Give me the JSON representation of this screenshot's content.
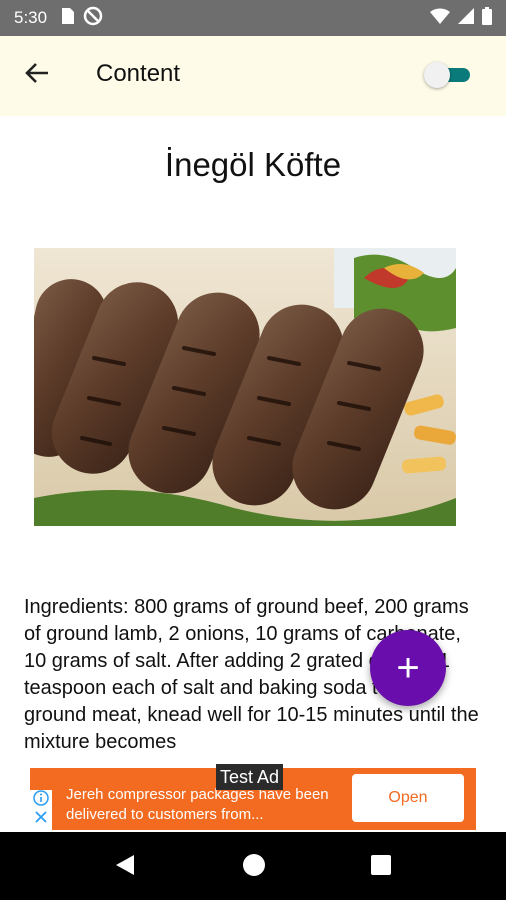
{
  "status_bar": {
    "time": "5:30",
    "icons": [
      "sd-card-icon",
      "do-not-disturb-icon",
      "wifi-icon",
      "cellular-signal-icon",
      "battery-icon"
    ]
  },
  "app_bar": {
    "title": "Content",
    "back_icon": "arrow-left-icon",
    "toggle_on": true
  },
  "recipe": {
    "title": "İnegöl Köfte",
    "image_description": "grilled meatballs",
    "text": "Ingredients: 800 grams of ground beef, 200 grams of ground lamb, 2 onions, 10 grams of carbonate, 10 grams of salt. After adding 2 grated onions, 1 teaspoon each of salt and baking soda to the ground meat, knead well for 10-15 minutes until the mixture becomes"
  },
  "fab": {
    "icon": "plus-icon",
    "label": "+"
  },
  "ad": {
    "badge": "Test Ad",
    "text": "Jereh compressor packages have been delivered to customers from...",
    "cta": "Open",
    "info_icon": "info-icon",
    "close_icon": "close-icon"
  },
  "nav_bar": {
    "buttons": [
      "back-triangle-icon",
      "home-circle-icon",
      "recents-square-icon"
    ]
  },
  "colors": {
    "status_bar": "#6e6e6e",
    "app_bar": "#fefce9",
    "fab": "#6a0dad",
    "ad_background": "#f26b21",
    "toggle_track": "#0a7b7a"
  }
}
